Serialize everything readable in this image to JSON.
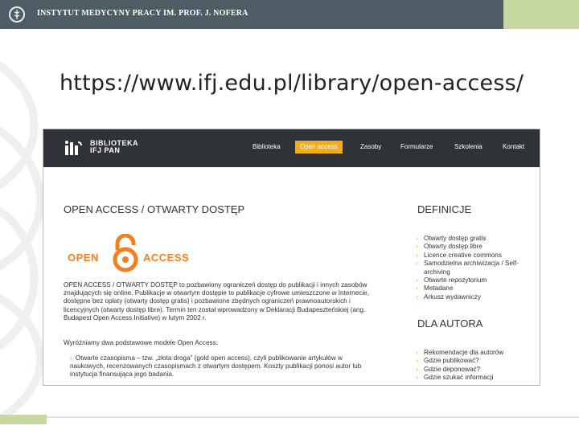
{
  "slide": {
    "organization": "INSTYTUT MEDYCYNY PRACY IM. PROF. J. NOFERA",
    "title": "https://www.ifj.edu.pl/library/open-access/"
  },
  "site": {
    "logo_line1": "BIBLIOTEKA",
    "logo_line2": "IFJ PAN",
    "nav": [
      "Biblioteka",
      "Open access",
      "Zasoby",
      "Formularze",
      "Szkolenia",
      "Kontakt"
    ],
    "active_nav": "Open access",
    "heading": "OPEN ACCESS / OTWARTY DOSTĘP",
    "oa_logo_left": "OPEN",
    "oa_logo_right": "ACCESS",
    "intro_paragraph": "OPEN ACCESS / OTWARTY DOSTĘP to pozbawiony ograniczeń dostęp do publikacji i innych zasobów znajdujących się online. Publikacje w otwartym dostępie to publikacje cyfrowe umieszczone w Internecie, dostępne bez opłaty (otwarty dostęp gratis) i pozbawione zbędnych ograniczeń prawnoautorskich i licencyjnych (otwarty dostęp libre). Termin ten został wprowadzony w Deklaracji Budapeszteńskiej (ang. Budapest Open Access Initiative) w lutym 2002 r.",
    "models_intro": "Wyróżniamy dwa podstawowe modele Open Access:",
    "model_bullet": "Otwarte czasopisma – tzw. „złota droga” (gold open access), czyli publikowanie artykułów w naukowych, recenzowanych czasopismach z otwartym dostępem. Koszty publikacji ponosi autor lub instytucja finansująca jego badania.",
    "definitions_heading": "DEFINICJE",
    "definitions": [
      "Otwarty dostęp gratis",
      "Otwarty dostęp libre",
      "Licence creative commons",
      "Samodzielna archiwizacja / Self-archiving",
      "Otwarte repozytorium",
      "Metadane",
      "Arkusz wydawniczy"
    ],
    "author_heading": "DLA AUTORA",
    "author_links": [
      "Rekomendacje dla autorów",
      "Gdzie publikować?",
      "Gdzie deponować?",
      "Gdzie szukać informacji"
    ]
  },
  "colors": {
    "header_bar": "#4e5c66",
    "header_accent": "#c7d7a0",
    "site_nav": "#2f3338",
    "nav_active": "#f3ad1c",
    "oa_orange": "#f57e20"
  }
}
